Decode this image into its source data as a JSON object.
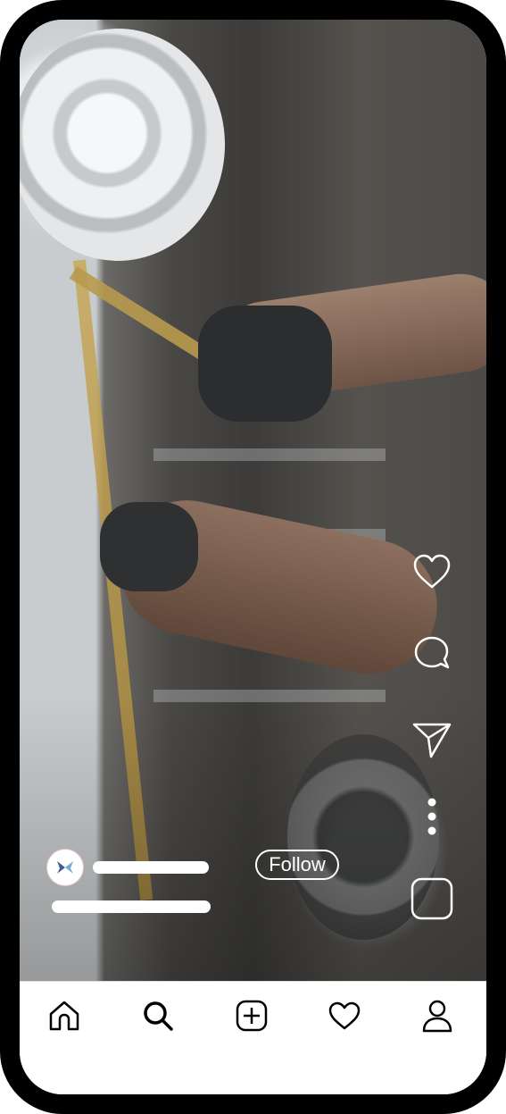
{
  "post": {
    "follow_label": "Follow"
  },
  "actions": [
    {
      "name": "heart-icon"
    },
    {
      "name": "comment-icon"
    },
    {
      "name": "send-icon"
    },
    {
      "name": "more-icon"
    },
    {
      "name": "square-icon"
    }
  ],
  "nav": [
    {
      "name": "home-icon"
    },
    {
      "name": "search-icon"
    },
    {
      "name": "create-icon"
    },
    {
      "name": "activity-heart-icon"
    },
    {
      "name": "profile-icon"
    }
  ]
}
